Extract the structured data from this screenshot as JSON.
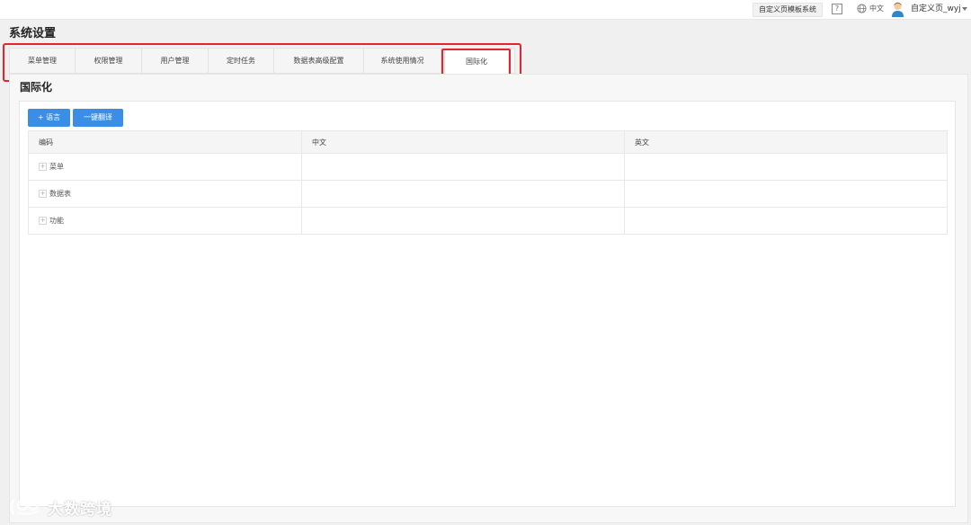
{
  "topbar": {
    "app_name": "自定义页模板系统",
    "help_label": "?",
    "language": "中文",
    "username": "自定义页_wyj"
  },
  "page": {
    "title": "系统设置",
    "section_title": "国际化"
  },
  "tabs": [
    {
      "label": "菜单管理",
      "active": false
    },
    {
      "label": "权限管理",
      "active": false
    },
    {
      "label": "用户管理",
      "active": false
    },
    {
      "label": "定时任务",
      "active": false
    },
    {
      "label": "数据表高级配置",
      "active": false
    },
    {
      "label": "系统使用情况",
      "active": false
    },
    {
      "label": "国际化",
      "active": true
    }
  ],
  "toolbar": {
    "add_language_label": "+ 语言",
    "auto_translate_label": "一键翻译"
  },
  "table": {
    "columns": [
      "编码",
      "中文",
      "英文"
    ],
    "rows": [
      {
        "code": "菜单",
        "zh": "",
        "en": ""
      },
      {
        "code": "数据表",
        "zh": "",
        "en": ""
      },
      {
        "code": "功能",
        "zh": "",
        "en": ""
      }
    ],
    "expander_symbol": "+"
  },
  "watermark": {
    "text": "大数跨境"
  },
  "colors": {
    "accent": "#3a8ee6",
    "highlight": "#e8232d"
  }
}
